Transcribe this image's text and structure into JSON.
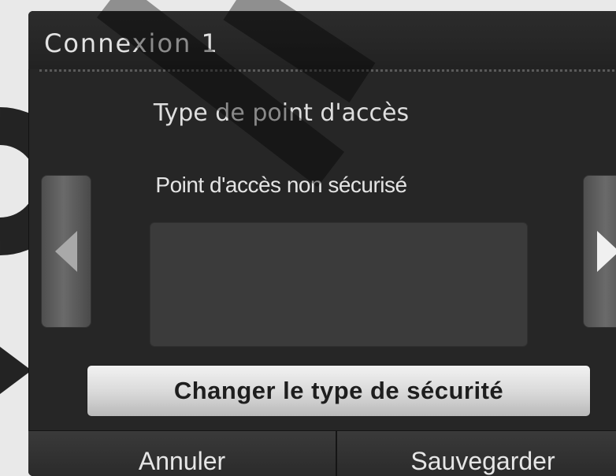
{
  "window": {
    "title": "Connexion 1"
  },
  "main": {
    "subtitle": "Type de point d'accès",
    "selected_value": "Point d'accès non sécurisé",
    "prev_icon": "triangle-left-icon",
    "next_icon": "triangle-right-icon"
  },
  "actions": {
    "change_security_label": "Changer le type de sécurité",
    "cancel_label": "Annuler",
    "save_label": "Sauvegarder"
  },
  "colors": {
    "screen_background": "#262626",
    "button_light": "#e6e6e6",
    "text_light": "#e2e2e2"
  }
}
